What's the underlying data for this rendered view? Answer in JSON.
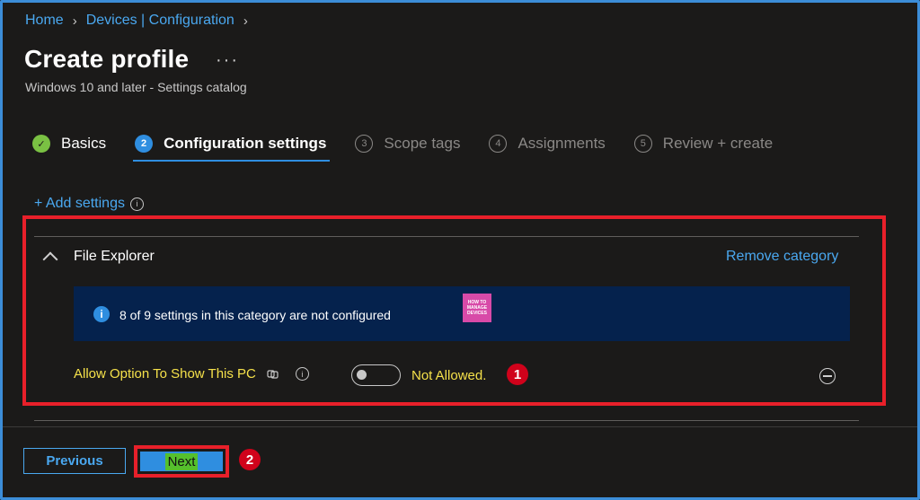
{
  "breadcrumb": [
    "Home",
    "Devices | Configuration"
  ],
  "page": {
    "title": "Create profile",
    "more": "···",
    "subtitle": "Windows 10 and later - Settings catalog"
  },
  "steps": [
    {
      "num": "✓",
      "label": "Basics",
      "state": "done"
    },
    {
      "num": "2",
      "label": "Configuration settings",
      "state": "active"
    },
    {
      "num": "3",
      "label": "Scope tags",
      "state": "todo"
    },
    {
      "num": "4",
      "label": "Assignments",
      "state": "todo"
    },
    {
      "num": "5",
      "label": "Review + create",
      "state": "todo"
    }
  ],
  "add_settings": "+ Add settings",
  "category": {
    "name": "File Explorer",
    "remove_label": "Remove category",
    "banner": "8 of 9 settings in this category are not configured",
    "logo_lines": [
      "HOW TO",
      "MANAGE",
      "DEVICES"
    ]
  },
  "setting": {
    "label": "Allow Option To Show This PC",
    "value_label": "Not Allowed.",
    "enabled": false
  },
  "annotations": {
    "one": "1",
    "two": "2"
  },
  "footer": {
    "previous": "Previous",
    "next": "Next"
  },
  "colors": {
    "accent": "#2f8ee0",
    "highlight_text": "#f5e14a",
    "callout": "#e8202a",
    "banner_bg": "#05224d"
  }
}
